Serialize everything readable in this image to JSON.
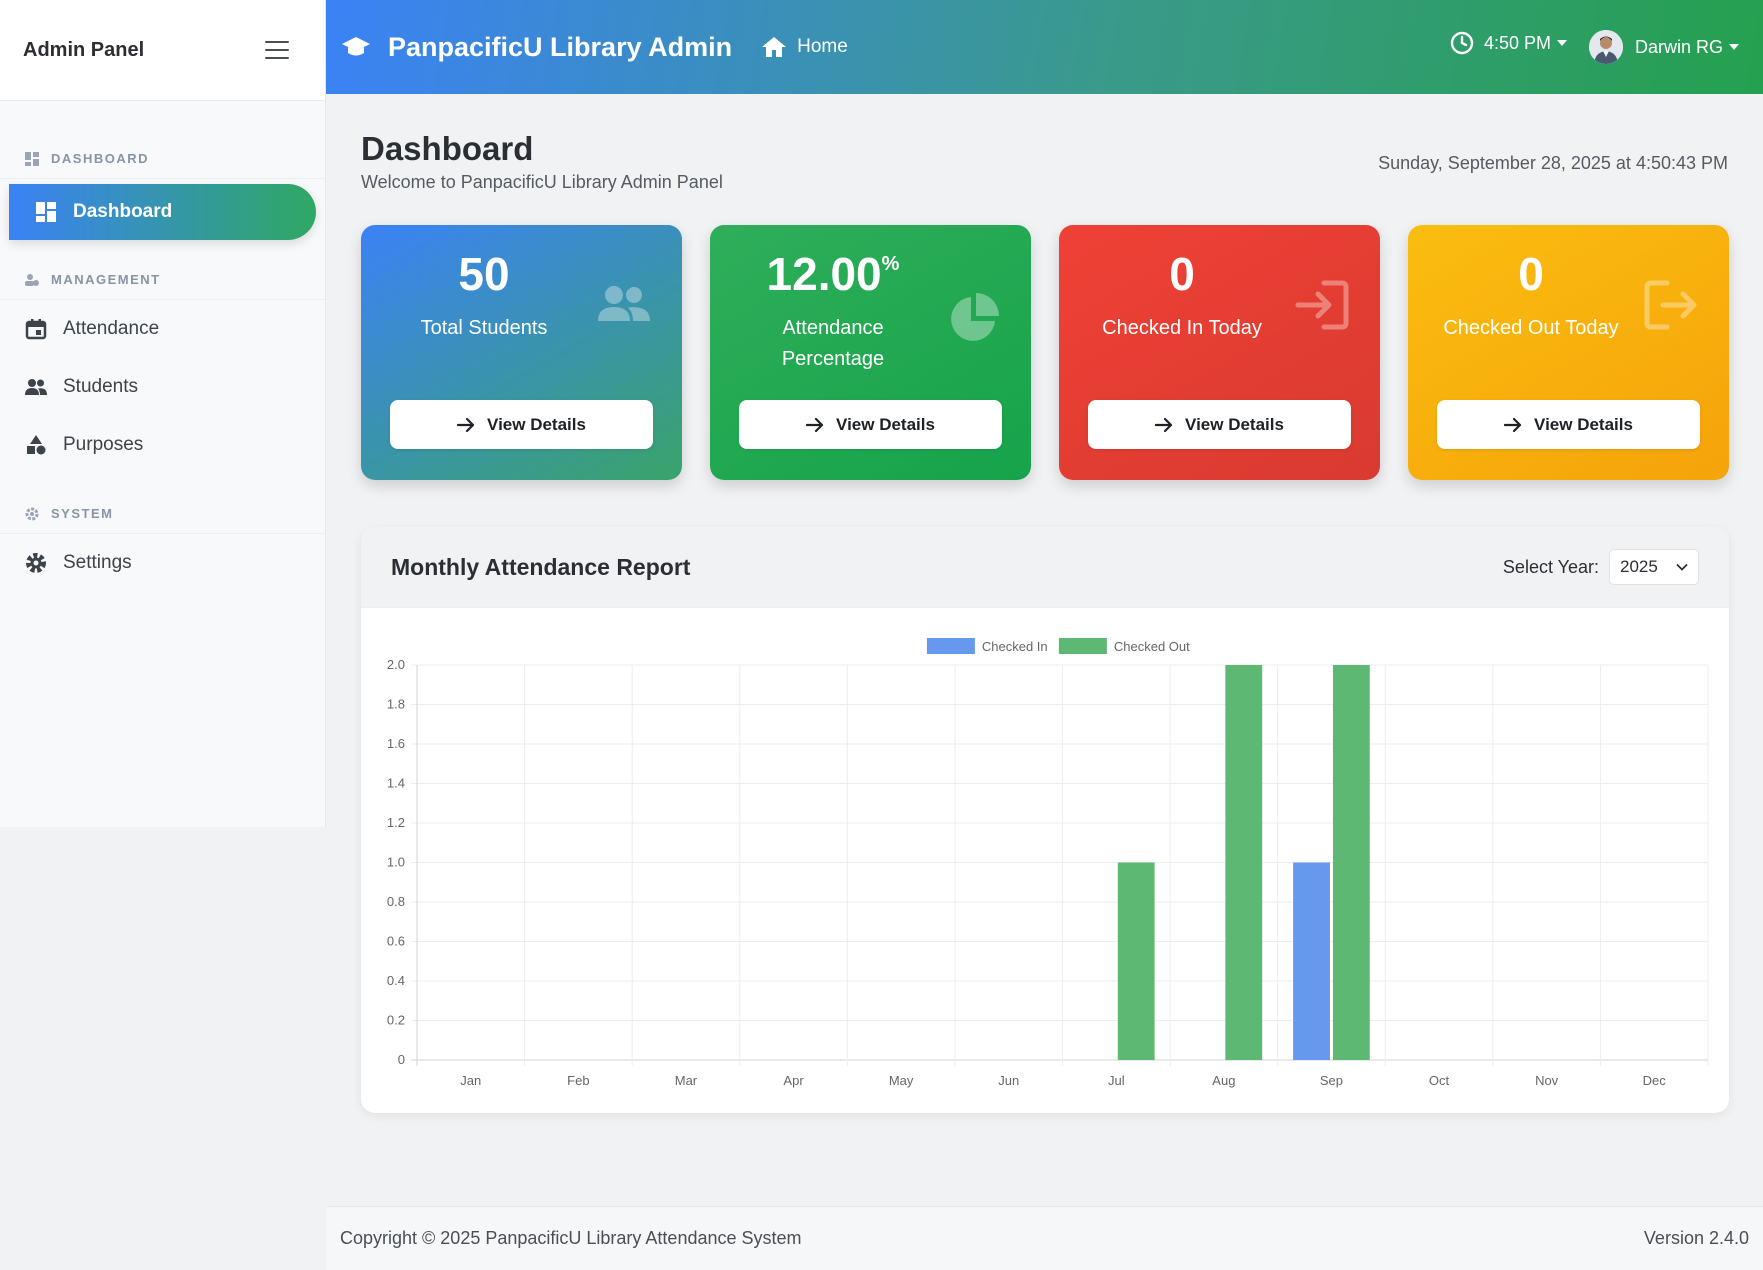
{
  "sidebar": {
    "brand_title": "Admin Panel",
    "sections": [
      {
        "label": "DASHBOARD"
      },
      {
        "label": "MANAGEMENT"
      },
      {
        "label": "SYSTEM"
      }
    ],
    "items": [
      {
        "label": "Dashboard",
        "icon": "dashboard-icon",
        "active": true
      },
      {
        "label": "Attendance",
        "icon": "calendar-icon"
      },
      {
        "label": "Students",
        "icon": "users-icon"
      },
      {
        "label": "Purposes",
        "icon": "shapes-icon"
      },
      {
        "label": "Settings",
        "icon": "gear-icon"
      }
    ]
  },
  "topbar": {
    "brand": "PanpacificU Library Admin",
    "home_label": "Home",
    "time": "4:50 PM",
    "user_name": "Darwin RG"
  },
  "page": {
    "title": "Dashboard",
    "subtitle": "Welcome to PanpacificU Library Admin Panel",
    "datetime": "Sunday, September 28, 2025 at 4:50:43 PM"
  },
  "cards": [
    {
      "value": "50",
      "label": "Total Students",
      "button": "View Details",
      "icon": "users-icon"
    },
    {
      "value": "12.00",
      "suffix": "%",
      "label": "Attendance Percentage",
      "label_line1": "Attendance",
      "label_line2": "Percentage",
      "button": "View Details",
      "icon": "pie-chart-icon"
    },
    {
      "value": "0",
      "label": "Checked In Today",
      "button": "View Details",
      "icon": "sign-in-icon"
    },
    {
      "value": "0",
      "label": "Checked Out Today",
      "button": "View Details",
      "icon": "sign-out-icon"
    }
  ],
  "report": {
    "title": "Monthly Attendance Report",
    "year_label": "Select Year:",
    "year_value": "2025"
  },
  "chart_data": {
    "type": "bar",
    "categories": [
      "Jan",
      "Feb",
      "Mar",
      "Apr",
      "May",
      "Jun",
      "Jul",
      "Aug",
      "Sep",
      "Oct",
      "Nov",
      "Dec"
    ],
    "series": [
      {
        "name": "Checked In",
        "color": "#6699ee",
        "values": [
          0,
          0,
          0,
          0,
          0,
          0,
          0,
          0,
          1,
          0,
          0,
          0
        ]
      },
      {
        "name": "Checked Out",
        "color": "#5cb872",
        "values": [
          0,
          0,
          0,
          0,
          0,
          0,
          1,
          2,
          2,
          0,
          0,
          0
        ]
      }
    ],
    "ylim": [
      0,
      2
    ],
    "yticks": [
      "0",
      "0.2",
      "0.4",
      "0.6",
      "0.8",
      "1.0",
      "1.2",
      "1.4",
      "1.6",
      "1.8",
      "2.0"
    ],
    "legend": "top-center",
    "grid": true
  },
  "footer": {
    "copyright": "Copyright © 2025 PanpacificU Library Attendance System",
    "version": "Version 2.4.0"
  }
}
